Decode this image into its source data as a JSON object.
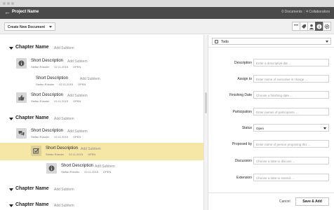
{
  "titlebar": {
    "project_name": "Project Name",
    "documents": "0 Documents",
    "separator": "|",
    "collaborators": "4 Collaborators"
  },
  "toolbar": {
    "create_label": "Create New Document",
    "icons": [
      "more-icon",
      "tag-icon",
      "user-icon",
      "info-icon",
      "settings-icon"
    ]
  },
  "outline": {
    "add_subitem": "Add Subitem",
    "chapters": [
      {
        "name": "Chapter Name"
      },
      {
        "name": "Chapter Name"
      },
      {
        "name": "Chapter Name"
      },
      {
        "name": "Chapter Name"
      }
    ],
    "items": [
      {
        "title": "Short Description",
        "author": "Stefan Rössler",
        "date": "02.11.2015",
        "status": "OPEN",
        "icon": "info-icon"
      },
      {
        "title": "Short Description",
        "author": "Stefan Rössler",
        "date": "02.11.2015",
        "status": "OPEN",
        "icon": "none"
      },
      {
        "title": "Short Description",
        "author": "Stefan Rössler",
        "date": "02.11.2015",
        "status": "OPEN",
        "icon": "thumbs-up-icon"
      },
      {
        "title": "Short Description",
        "author": "Stefan Rössler",
        "date": "02.11.2015",
        "status": "OPEN",
        "icon": "chat-icon"
      },
      {
        "title": "Short Description",
        "author": "Stefan Rössler",
        "date": "02.11.2015",
        "status": "OPEN",
        "icon": "checkbox-icon"
      },
      {
        "title": "Short Description",
        "author": "Stefan Rössler",
        "date": "02.11.2015",
        "status": "OPEN",
        "icon": "info-icon"
      }
    ]
  },
  "form": {
    "type": "Todo",
    "fields": [
      {
        "label": "Description",
        "placeholder": "Enter a descriptive dat ..."
      },
      {
        "label": "Assign to",
        "placeholder": "Enter name of executive in charge ..."
      },
      {
        "label": "Finishing Date",
        "placeholder": "Choose a finishing date ..."
      },
      {
        "label": "Participation",
        "placeholder": "Enter names of participants ..."
      },
      {
        "label": "Status",
        "value": "Open"
      },
      {
        "label": "Proposed by",
        "placeholder": "Enter name of person proposing this ..."
      },
      {
        "label": "Discussion",
        "placeholder": "Choose a date to discuss ..."
      },
      {
        "label": "Extension",
        "placeholder": "Choose a date to extend ..."
      }
    ],
    "cancel": "Cancel",
    "save": "Save & Add"
  },
  "colors": {
    "titlebar": "#4a4a4a",
    "highlight": "#f7e7a6",
    "tile": "#d6d6d6"
  }
}
